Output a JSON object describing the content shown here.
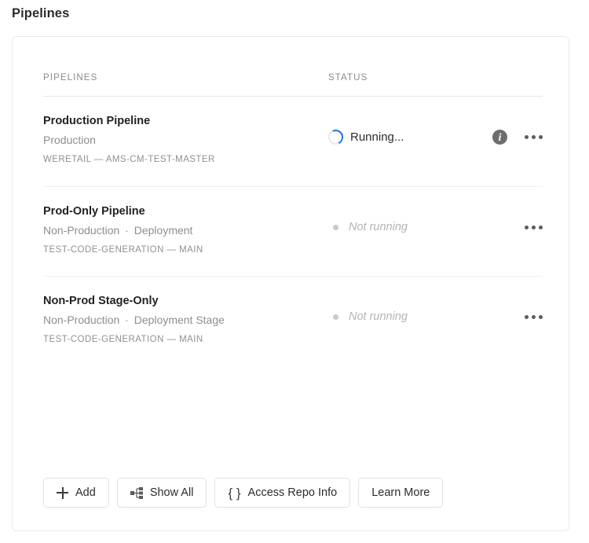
{
  "page": {
    "title": "Pipelines"
  },
  "table": {
    "headers": {
      "pipelines": "PIPELINES",
      "status": "STATUS"
    },
    "rows": [
      {
        "name": "Production Pipeline",
        "environment": "Production",
        "kind": "",
        "repo": "WERETAIL — AMS-CM-TEST-MASTER",
        "status_label": "Running...",
        "status_state": "running",
        "has_info_icon": true,
        "info_icon": "info-icon",
        "more_icon": "more-icon"
      },
      {
        "name": "Prod-Only Pipeline",
        "environment": "Non-Production",
        "kind": "Deployment",
        "separator": "·",
        "repo": "TEST-CODE-GENERATION — MAIN",
        "status_label": "Not running",
        "status_state": "idle",
        "has_info_icon": false,
        "more_icon": "more-icon"
      },
      {
        "name": "Non-Prod Stage-Only",
        "environment": "Non-Production",
        "kind": "Deployment Stage",
        "separator": "·",
        "repo": "TEST-CODE-GENERATION — MAIN",
        "status_label": "Not running",
        "status_state": "idle",
        "has_info_icon": false,
        "more_icon": "more-icon"
      }
    ]
  },
  "footer": {
    "buttons": [
      {
        "label": "Add",
        "icon": "plus-icon"
      },
      {
        "label": "Show All",
        "icon": "hierarchy-icon"
      },
      {
        "label": "Access Repo Info",
        "icon": "braces-icon",
        "icon_glyph": "{ }"
      },
      {
        "label": "Learn More",
        "icon": ""
      }
    ]
  },
  "colors": {
    "spinner_accent": "#1473E6",
    "idle_dot": "#c9c9c9",
    "info_badge": "#6d6d6d",
    "card_border": "#eaeaea",
    "divider": "#eeeeee",
    "muted_text": "#8e8e8e"
  }
}
